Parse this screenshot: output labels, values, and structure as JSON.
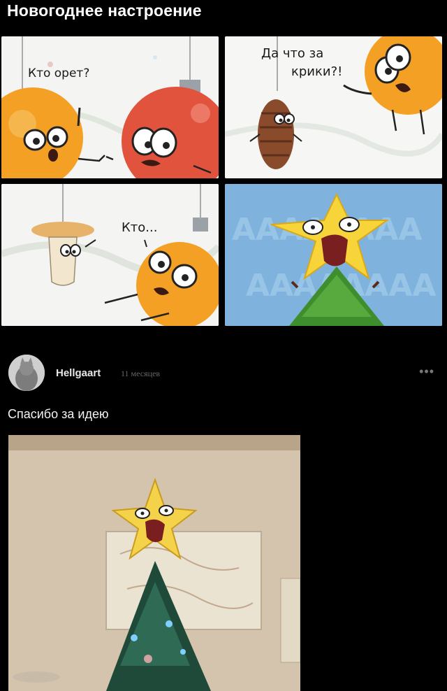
{
  "post": {
    "title": "Новогоднее настроение"
  },
  "comic": {
    "panel1_text": "Кто орет?",
    "panel2_text_line1": "Да что за",
    "panel2_text_line2": "крики?!",
    "panel3_text": "Кто...",
    "panel4_scream": "АААААААА"
  },
  "comment": {
    "author": "Hellgaart",
    "time": "11 месяцев",
    "more_icon": "•••",
    "text": "Спасибо за идею"
  }
}
